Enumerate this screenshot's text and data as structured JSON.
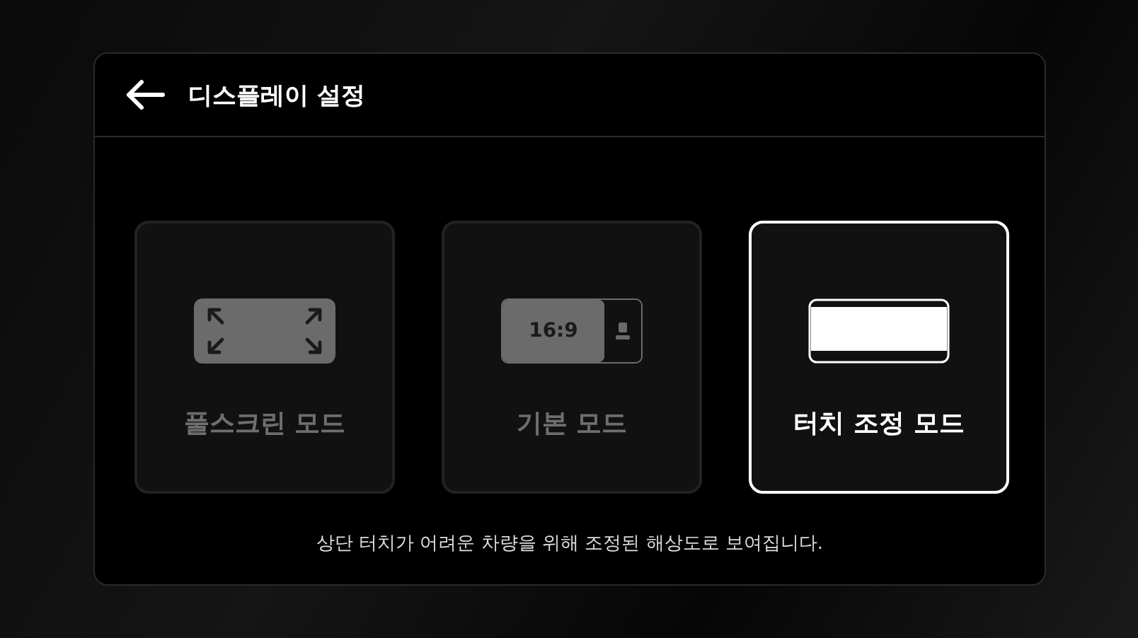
{
  "header": {
    "title": "디스플레이 설정"
  },
  "modes": [
    {
      "kind": "fullscreen",
      "label": "풀스크린 모드",
      "selected": false
    },
    {
      "kind": "standard",
      "label": "기본 모드",
      "ratio": "16:9",
      "selected": false
    },
    {
      "kind": "touch",
      "label": "터치 조정 모드",
      "selected": true
    }
  ],
  "caption": "상단 터치가 어려운 차량을 위해 조정된 해상도로 보여집니다."
}
